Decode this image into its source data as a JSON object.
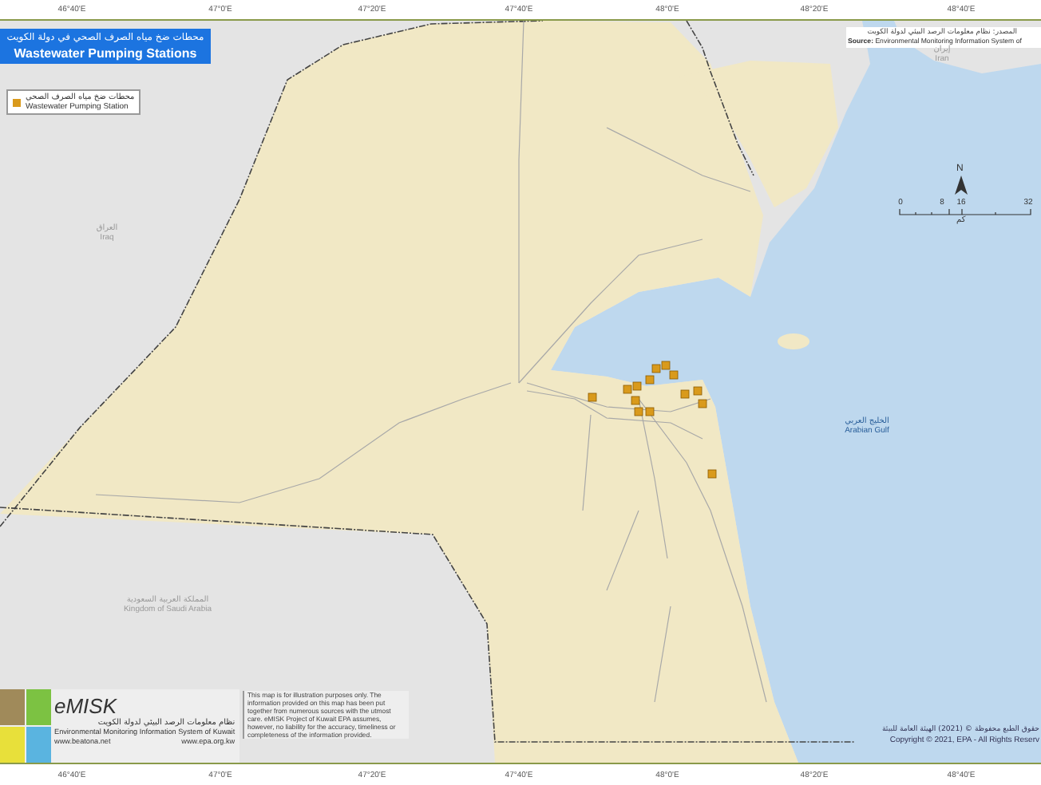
{
  "top_ticks": [
    "46°40'E",
    "47°0'E",
    "47°20'E",
    "47°40'E",
    "48°0'E",
    "48°20'E",
    "48°40'E"
  ],
  "title": {
    "arabic": "محطات ضخ مياه الصرف الصحي في دولة الكويت",
    "english": "Wastewater Pumping Stations"
  },
  "legend": {
    "items": [
      {
        "arabic": "محطات ضخ مياه الصرف الصحي",
        "english": "Wastewater Pumping Station",
        "color": "#d99a1c"
      }
    ]
  },
  "source": {
    "arabic": "المصدر: نظام معلومات الرصد البيئي لدولة الكويت",
    "english": "**Source:** Environmental Monitoring Information System of"
  },
  "scale": {
    "north": "N",
    "ticks": [
      "0",
      "8",
      "16",
      "32"
    ],
    "unit": "كم"
  },
  "map_labels": [
    {
      "arabic": "العراق",
      "english": "Iraq"
    },
    {
      "arabic": "إيران",
      "english": "Iran"
    },
    {
      "arabic": "الخليج العربي",
      "english": "Arabian Gulf"
    },
    {
      "arabic": "المملكة العربية السعودية",
      "english": "Kingdom of Saudi Arabia"
    }
  ],
  "logo": {
    "name": "eMISK",
    "arabic": "نظام معلومات الرصد البيئي لدولة الكويت",
    "english": "Environmental Monitoring Information System of Kuwait",
    "links": [
      "www.beatona.net",
      "www.epa.org.kw"
    ]
  },
  "disclaimer": "This map is for illustration purposes only. The information provided on this map has been put together from numerous sources with the utmost care. eMISK Project of Kuwait EPA assumes, however, no liability for the accuracy, timeliness or completeness of the information provided.",
  "copyright": {
    "arabic": "حقوق الطبع محفوظة © (2021) الهيئة العامة للبيئة",
    "english": "Copyright © 2021, EPA - All Rights Reserv"
  },
  "bottom_ticks": [
    "46°40'E",
    "47°0'E",
    "47°20'E",
    "47°40'E",
    "48°0'E",
    "48°20'E",
    "48°40'E"
  ]
}
